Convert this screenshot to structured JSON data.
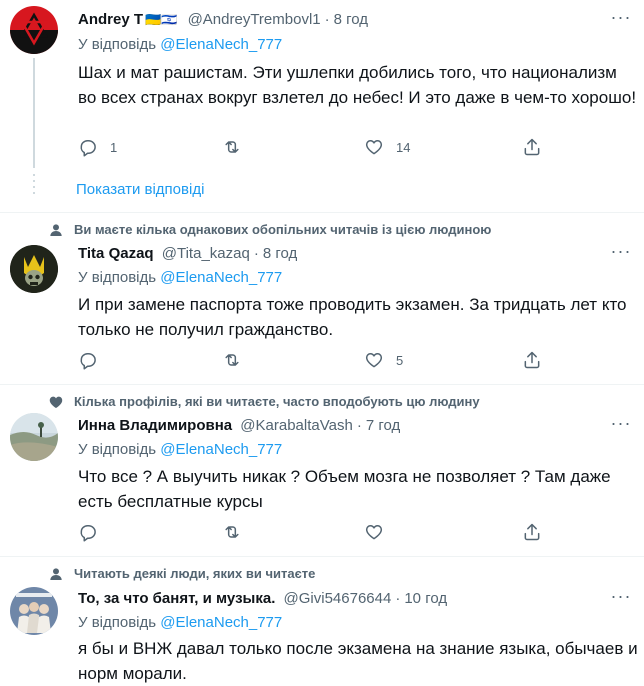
{
  "colors": {
    "link": "#1d9bf0",
    "muted": "#536471",
    "text": "#0f1419",
    "divider": "#eff3f4"
  },
  "tweets": [
    {
      "name": "Andrey T",
      "name_emoji": "🇺🇦🇮🇱",
      "handle": "@AndreyTrembovl1",
      "time": "8 год",
      "reply_prefix": "У відповідь",
      "reply_handle": "@ElenaNech_777",
      "text": "Шах и мат рашистам. Эти ушлепки добились того, что национализм во всех странах вокруг взлетел до небес! И это даже в чем-то хорошо!",
      "replies": "1",
      "retweets": "",
      "likes": "14",
      "avatar_icon": "red-black-star-of-david-avatar"
    },
    {
      "social_context": "Ви маєте кілька однакових обопільних читачів із цією людиною",
      "name": "Tita Qazaq",
      "handle": "@Tita_kazaq",
      "time": "8 год",
      "reply_prefix": "У відповідь",
      "reply_handle": "@ElenaNech_777",
      "text": "И при замене паспорта тоже проводить экзамен. За тридцать лет кто только не получил гражданство.",
      "replies": "",
      "retweets": "",
      "likes": "5",
      "avatar_icon": "trident-skull-avatar"
    },
    {
      "social_context": "Кілька профілів, які ви читаєте, часто вподобують цю людину",
      "name": "Инна Владимировна",
      "handle": "@KarabaltaVash",
      "time": "7 год",
      "reply_prefix": "У відповідь",
      "reply_handle": "@ElenaNech_777",
      "text": "Что все ? А выучить никак ? Объем мозга не позволяет ? Там даже есть бесплатные курсы",
      "replies": "",
      "retweets": "",
      "likes": "",
      "avatar_icon": "landscape-photo-avatar"
    },
    {
      "social_context": "Читають деякі люди, яких ви читаєте",
      "name": "То, за что банят, и музыка.",
      "handle": "@Givi54676644",
      "time": "10 год",
      "reply_prefix": "У відповідь",
      "reply_handle": "@ElenaNech_777",
      "text": "я бы и ВНЖ давал только после экзамена на знание языка, обычаев и норм морали.",
      "avatar_icon": "group-photo-avatar"
    }
  ],
  "show_replies": "Показати відповіді"
}
